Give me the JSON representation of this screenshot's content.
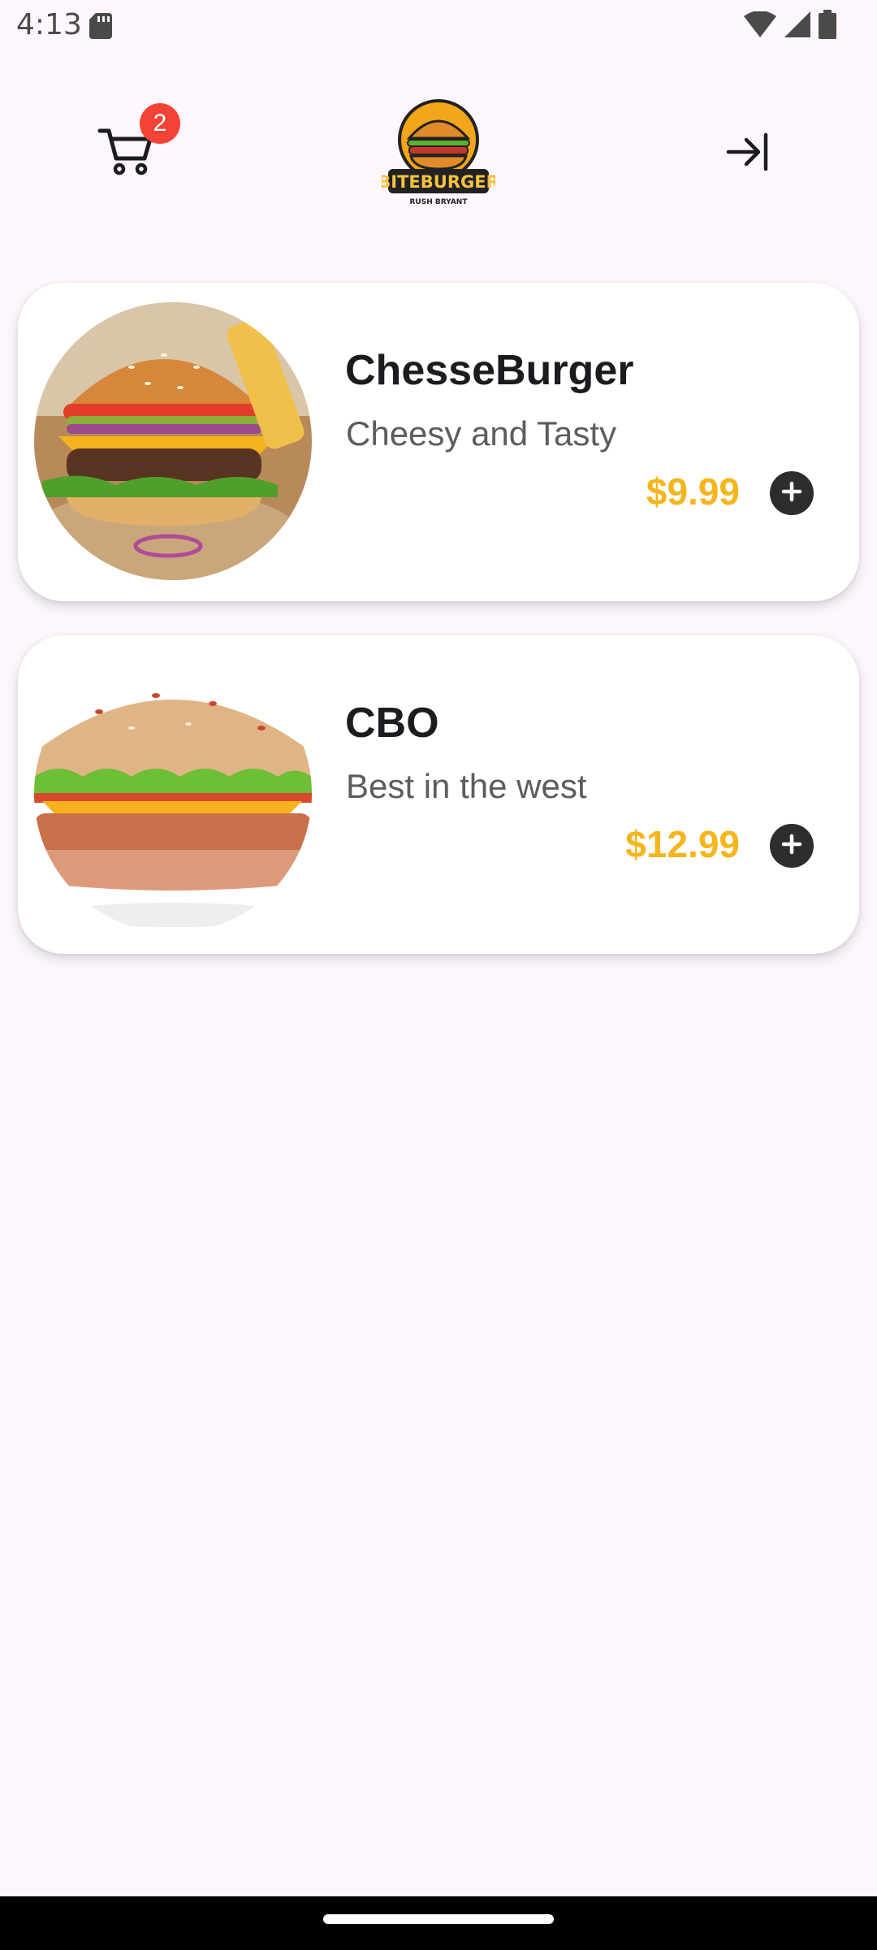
{
  "status_bar": {
    "time": "4:13",
    "icons": [
      "sd-card-icon",
      "wifi-icon",
      "signal-icon",
      "battery-icon"
    ]
  },
  "header": {
    "cart_count": "2",
    "logo_text": "BITEBURGER",
    "logo_subtext": "RUSH BRYANT",
    "icons": [
      "cart-icon",
      "logout-icon"
    ]
  },
  "menu_items": [
    {
      "name": "ChesseBurger",
      "description": "Cheesy and Tasty",
      "price": "$9.99"
    },
    {
      "name": "CBO",
      "description": "Best in the west",
      "price": "$12.99"
    }
  ],
  "colors": {
    "background": "#fdf6fc",
    "price": "#f5b51c",
    "badge": "#f44336",
    "add_button": "#2d2d2d"
  }
}
